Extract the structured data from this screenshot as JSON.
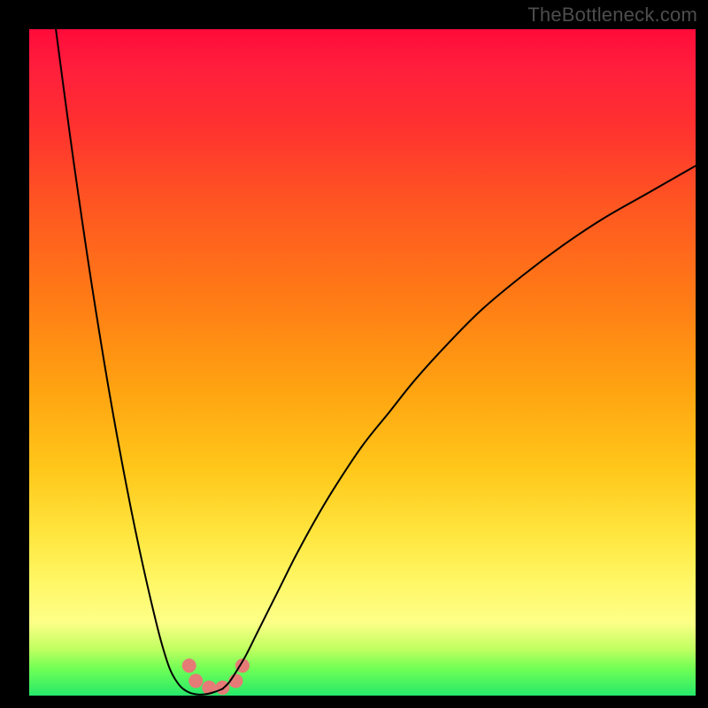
{
  "watermark": "TheBottleneck.com",
  "chart_data": {
    "type": "line",
    "title": "",
    "xlabel": "",
    "ylabel": "",
    "xlim": [
      0,
      100
    ],
    "ylim": [
      0,
      100
    ],
    "grid": false,
    "legend": false,
    "background_gradient": {
      "stops": [
        {
          "pos": 0.0,
          "color": "#ff0b3a"
        },
        {
          "pos": 0.5,
          "color": "#ffb015"
        },
        {
          "pos": 0.85,
          "color": "#fff766"
        },
        {
          "pos": 1.0,
          "color": "#26e96a"
        }
      ]
    },
    "dots": {
      "color": "#e67a77",
      "radius_px": 8,
      "points_xy": [
        [
          24.0,
          4.5
        ],
        [
          25.0,
          2.2
        ],
        [
          27.0,
          1.2
        ],
        [
          29.0,
          1.2
        ],
        [
          31.0,
          2.2
        ],
        [
          32.0,
          4.5
        ]
      ]
    },
    "series": [
      {
        "name": "left-branch",
        "color": "#000000",
        "x": [
          4.0,
          5.32,
          6.63,
          7.95,
          9.26,
          10.58,
          11.89,
          13.21,
          14.53,
          15.84,
          17.16,
          18.47,
          19.79,
          21.11,
          22.42,
          23.74,
          25.05,
          26.37,
          27.68,
          29.0
        ],
        "y": [
          100.0,
          90.0,
          80.4,
          71.21,
          62.46,
          54.14,
          46.26,
          38.82,
          31.81,
          25.24,
          19.1,
          13.4,
          8.14,
          4.0,
          1.7,
          0.6,
          0.2,
          0.2,
          0.5,
          1.0
        ]
      },
      {
        "name": "right-branch",
        "color": "#000000",
        "x": [
          29.0,
          30.0,
          31.0,
          32.5,
          34.0,
          36.0,
          38.0,
          40.0,
          43.0,
          46.0,
          50.0,
          54.0,
          58.0,
          63.0,
          68.0,
          74.0,
          80.0,
          86.0,
          93.0,
          100.0
        ],
        "y": [
          1.0,
          2.0,
          3.5,
          6.0,
          9.0,
          13.0,
          17.0,
          21.0,
          26.5,
          31.5,
          37.5,
          42.5,
          47.5,
          53.0,
          58.0,
          63.0,
          67.5,
          71.5,
          75.5,
          79.5
        ]
      }
    ]
  }
}
